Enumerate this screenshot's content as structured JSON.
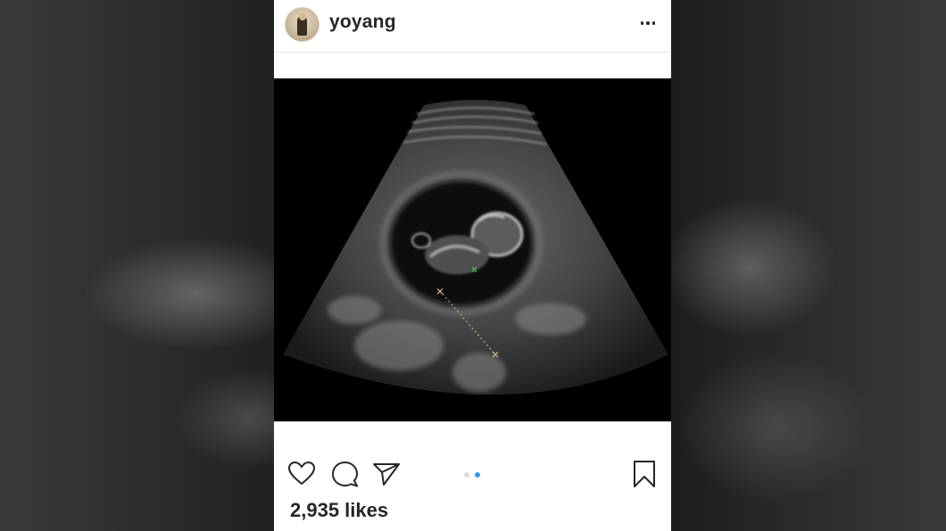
{
  "post": {
    "username": "yoyang",
    "likes_text": "2,935 likes",
    "carousel": {
      "count": 2,
      "active_index": 1
    }
  },
  "colors": {
    "text": "#262626",
    "dot_active": "#3897f0",
    "dot_inactive": "#dbdbdb",
    "photo_bg": "#000000"
  },
  "icons": {
    "like": "heart-icon",
    "comment": "comment-bubble-icon",
    "share": "paper-plane-icon",
    "save": "bookmark-icon",
    "more": "more-options-icon"
  }
}
